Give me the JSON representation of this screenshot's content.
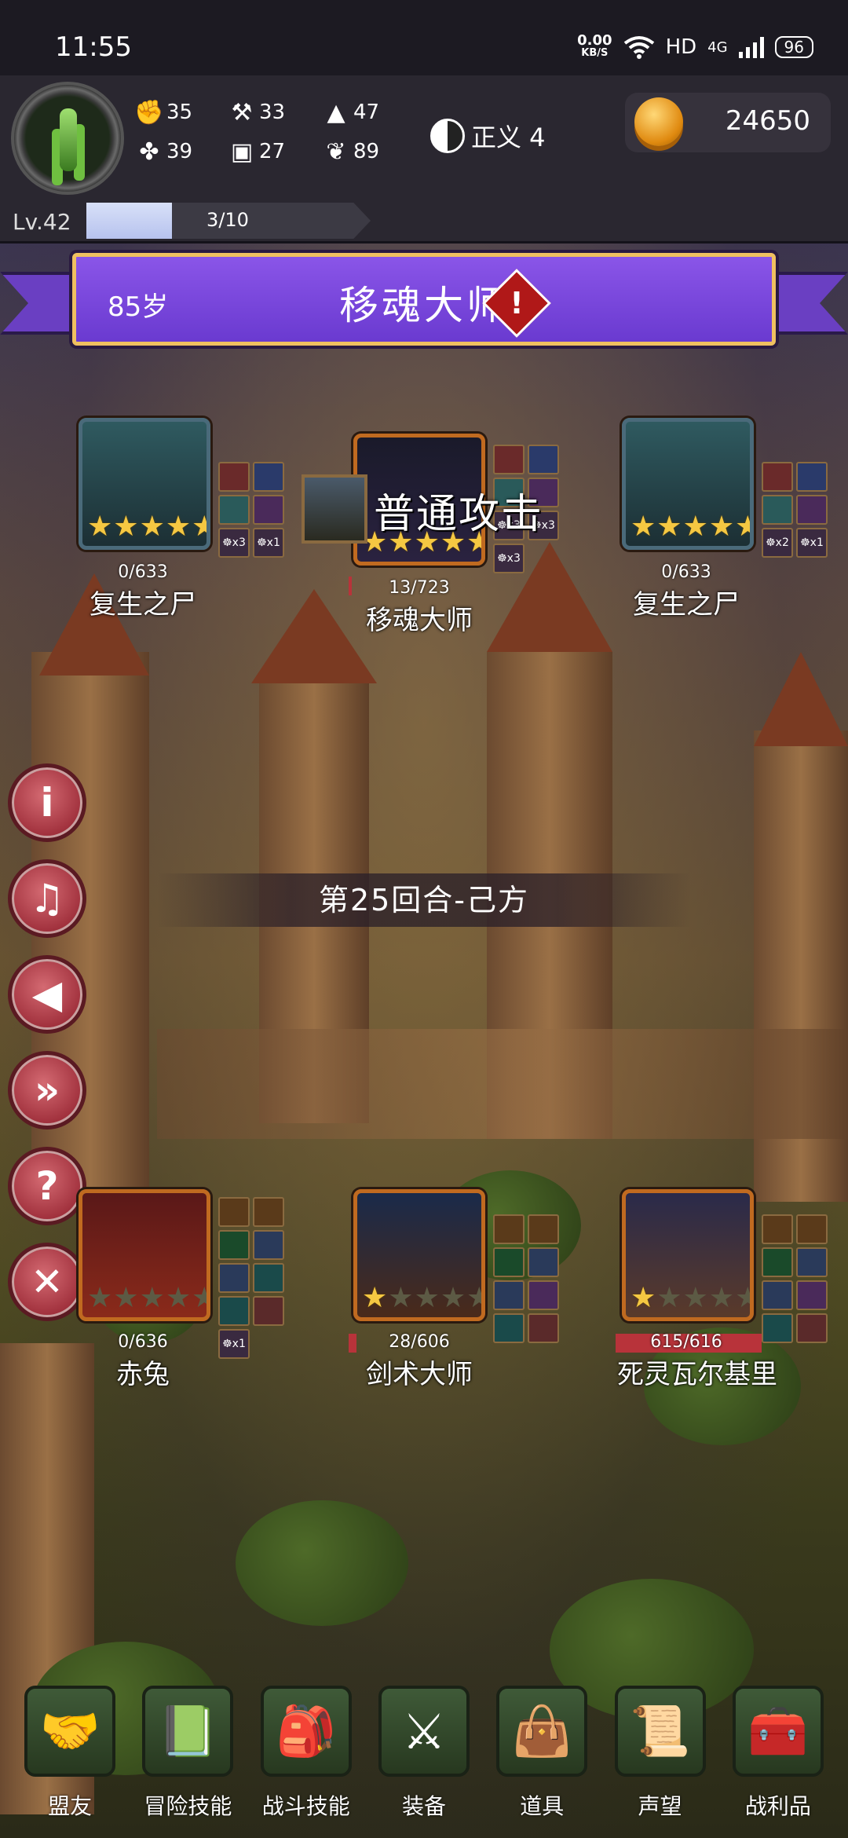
{
  "status_bar": {
    "time": "11:55",
    "speed_value": "0.00",
    "speed_unit": "KB/S",
    "hd": "HD",
    "network": "4G",
    "battery": "96"
  },
  "player": {
    "stats": [
      {
        "icon": "fist-icon",
        "value": "35"
      },
      {
        "icon": "axe-icon",
        "value": "33"
      },
      {
        "icon": "wizard-hat-icon",
        "value": "47"
      },
      {
        "icon": "clover-icon",
        "value": "39"
      },
      {
        "icon": "armor-icon",
        "value": "27"
      },
      {
        "icon": "flower-icon",
        "value": "89"
      }
    ],
    "alignment": "正义 4",
    "gold": "24650",
    "level": "Lv.42",
    "xp": "3/10",
    "xp_fraction": 0.3
  },
  "banner": {
    "age": "85岁",
    "name": "移魂大师"
  },
  "enemies": [
    {
      "name": "复生之尸",
      "hp": "0/633",
      "stars": 5,
      "skills": [
        "",
        "",
        "",
        "",
        "☸x3",
        "☸x1"
      ]
    },
    {
      "name": "移魂大师",
      "hp": "13/723",
      "stars": 5,
      "skills": [
        "",
        "",
        "",
        "",
        "☸x3",
        "☸x3",
        "☸x3"
      ]
    },
    {
      "name": "复生之尸",
      "hp": "0/633",
      "stars": 5,
      "skills": [
        "",
        "",
        "",
        "",
        "☸x2",
        "☸x1"
      ]
    }
  ],
  "action_text": "普通攻击",
  "round_text": "第25回合-己方",
  "allies": [
    {
      "name": "赤兔",
      "hp": "0/636",
      "stars": 0,
      "skills": [
        "",
        "",
        "",
        "",
        "",
        "",
        "",
        "",
        "☸x1"
      ]
    },
    {
      "name": "剑术大师",
      "hp": "28/606",
      "stars": 1,
      "skills": [
        "",
        "",
        "",
        "",
        "",
        "",
        "",
        ""
      ]
    },
    {
      "name": "死灵瓦尔基里",
      "hp": "615/616",
      "stars": 1,
      "skills": [
        "",
        "",
        "",
        "",
        "",
        "",
        "",
        ""
      ]
    }
  ],
  "side_buttons": [
    "info-icon",
    "music-icon",
    "sound-icon",
    "fast-forward-icon",
    "help-icon",
    "close-icon"
  ],
  "nav": [
    {
      "label": "盟友",
      "icon": "handshake-icon"
    },
    {
      "label": "冒险技能",
      "icon": "spellbook-icon"
    },
    {
      "label": "战斗技能",
      "icon": "backpack-icon"
    },
    {
      "label": "装备",
      "icon": "shield-swords-icon"
    },
    {
      "label": "道具",
      "icon": "satchel-icon"
    },
    {
      "label": "声望",
      "icon": "scroll-icon"
    },
    {
      "label": "战利品",
      "icon": "treasure-chest-icon"
    }
  ]
}
